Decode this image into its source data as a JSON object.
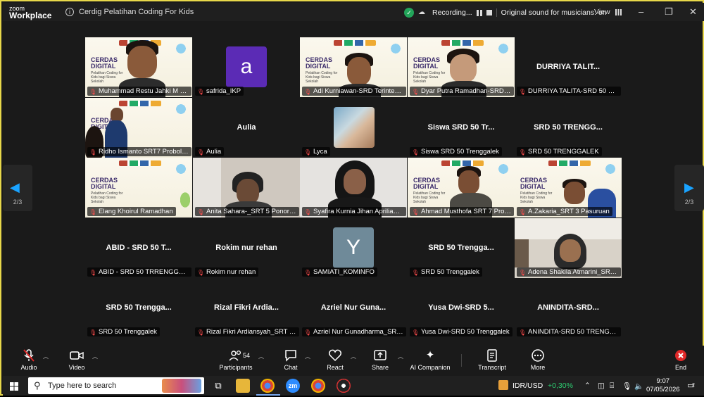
{
  "window": {
    "brand_top": "zoom",
    "brand_bottom": "Workplace",
    "title": "Cerdig Pelatihan Coding For Kids",
    "recording_text": "Recording...",
    "sound_text": "Original sound for musicians: on",
    "view_label": "View",
    "minimize": "–",
    "maximize": "❐",
    "close": "✕"
  },
  "pagination": {
    "left": "2/3",
    "right": "2/3"
  },
  "tiles": [
    {
      "id": "t1",
      "label": "Muhammad Restu Jahki M - SRD..",
      "type": "video"
    },
    {
      "id": "t2",
      "label": "safrida_IKP",
      "type": "avatar",
      "avatar_letter": "a",
      "avatar_color": "#5b2bb5"
    },
    {
      "id": "t3",
      "label": "Adi Kurniawan-SRD Terintegr...",
      "type": "video"
    },
    {
      "id": "t4",
      "label": "Dyar Putra Ramadhan-SRD Te...",
      "type": "video"
    },
    {
      "id": "t5",
      "label": "DURRIYA TALITA-SRD 50 TRE...",
      "type": "name",
      "big_name": "DURRIYA TALIT..."
    },
    {
      "id": "t6",
      "label": "Ridho Ismanto SRT7 Probolin...",
      "type": "video"
    },
    {
      "id": "t7",
      "label": "Aulia",
      "type": "name",
      "big_name": "Aulia"
    },
    {
      "id": "t8",
      "label": "Lyca",
      "type": "photo"
    },
    {
      "id": "t9",
      "label": "Siswa SRD 50 Trenggalek",
      "type": "name",
      "big_name": "Siswa SRD 50 Tr..."
    },
    {
      "id": "t10",
      "label": "SRD 50 TRENGGALEK",
      "type": "name",
      "big_name": "SRD 50 TRENGG..."
    },
    {
      "id": "t11",
      "label": "Elang Khoirul Ramadhan",
      "type": "video"
    },
    {
      "id": "t12",
      "label": "Anita Sahara-_SRT 5 Ponorogo",
      "type": "video"
    },
    {
      "id": "t13",
      "label": "Syafira Kurnia Jihan Apriliani_...",
      "type": "video"
    },
    {
      "id": "t14",
      "label": "Ahmad Musthofa SRT 7 Prob...",
      "type": "video"
    },
    {
      "id": "t15",
      "label": "A.Zakaria_SRT 3 Pasuruan",
      "type": "video"
    },
    {
      "id": "t16",
      "label": "ABID - SRD 50 TRRENGGALEK",
      "type": "name",
      "big_name": "ABID - SRD 50 T..."
    },
    {
      "id": "t17",
      "label": "Rokim nur rehan",
      "type": "name",
      "big_name": "Rokim nur rehan"
    },
    {
      "id": "t18",
      "label": "SAMIATI_KOMINFO",
      "type": "avatar",
      "avatar_letter": "Y",
      "avatar_color": "#6f8a99"
    },
    {
      "id": "t19",
      "label": "SRD 50 Trenggalek",
      "type": "name",
      "big_name": "SRD 50 Trengga..."
    },
    {
      "id": "t20",
      "label": "Adena Shakila Atmarini_SRT 5...",
      "type": "video"
    },
    {
      "id": "t21",
      "label": "SRD 50 Trenggalek",
      "type": "name",
      "big_name": "SRD 50 Trengga..."
    },
    {
      "id": "t22",
      "label": "Rizal Fikri Ardiansyah_SRT 5 P...",
      "type": "name",
      "big_name": "Rizal Fikri Ardia..."
    },
    {
      "id": "t23",
      "label": "Azriel Nur Gunadharma_SRT 5...",
      "type": "name",
      "big_name": "Azriel Nur Guna..."
    },
    {
      "id": "t24",
      "label": "Yusa Dwi-SRD 50 Trenggalek",
      "type": "name",
      "big_name": "Yusa Dwi-SRD 5..."
    },
    {
      "id": "t25",
      "label": "ANINDITA-SRD 50 TRENGGAL...",
      "type": "name",
      "big_name": "ANINDITA-SRD..."
    }
  ],
  "banner": {
    "title_line1": "CERDAS",
    "title_line2": "DIGITAL",
    "subtitle": "Pelatihan Coding for Kids bagi Siswa Sekolah"
  },
  "toolbar": {
    "audio": "Audio",
    "video": "Video",
    "participants": "Participants",
    "participants_count": "54",
    "chat": "Chat",
    "react": "React",
    "share": "Share",
    "ai_companion": "AI Companion",
    "transcript": "Transcript",
    "more": "More",
    "end": "End"
  },
  "taskbar": {
    "search_placeholder": "Type here to search",
    "currency": "IDR/USD",
    "currency_change": "+0,30%",
    "time": "9:07",
    "date": "07/05/2026",
    "notifications": "2"
  },
  "colors": {
    "accent": "#1aa3ff",
    "end": "#e02828",
    "positive": "#2ecc71"
  }
}
